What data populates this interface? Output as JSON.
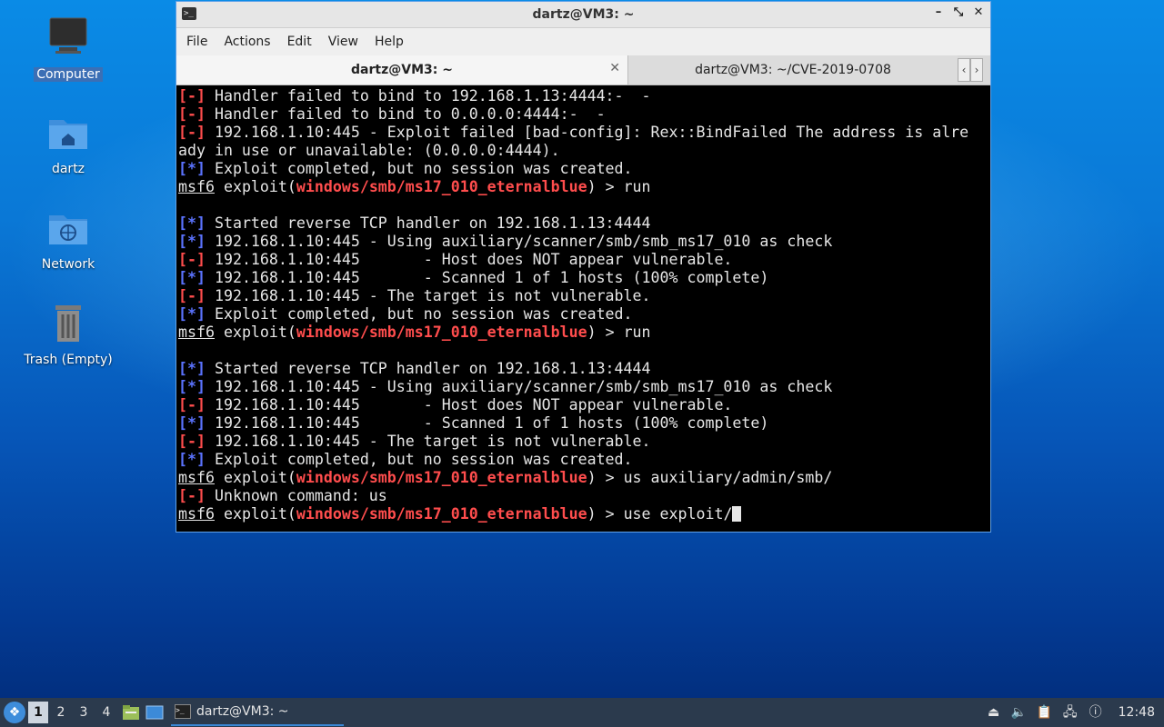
{
  "desktop": {
    "icons": [
      {
        "label": "Computer",
        "icon": "computer-icon"
      },
      {
        "label": "dartz",
        "icon": "home-folder-icon"
      },
      {
        "label": "Network",
        "icon": "network-folder-icon"
      },
      {
        "label": "Trash (Empty)",
        "icon": "trash-icon"
      }
    ]
  },
  "window": {
    "title": "dartz@VM3: ~",
    "menu": [
      "File",
      "Actions",
      "Edit",
      "View",
      "Help"
    ],
    "tabs": [
      {
        "label": "dartz@VM3: ~",
        "active": true
      },
      {
        "label": "dartz@VM3: ~/CVE-2019-0708",
        "active": false
      }
    ],
    "controls": {
      "minimize": "–",
      "maximize": "⤡",
      "close": "✕"
    }
  },
  "terminal": {
    "prompt": "msf6",
    "module": "windows/smb/ms17_010_eternalblue",
    "lines": [
      {
        "type": "err",
        "text": " Handler failed to bind to 192.168.1.13:4444:-  -"
      },
      {
        "type": "err",
        "text": " Handler failed to bind to 0.0.0.0:4444:-  -"
      },
      {
        "type": "err",
        "text": " 192.168.1.10:445 - Exploit failed [bad-config]: Rex::BindFailed The address is alre"
      },
      {
        "type": "plain",
        "text": "ady in use or unavailable: (0.0.0.0:4444)."
      },
      {
        "type": "info",
        "text": " Exploit completed, but no session was created."
      },
      {
        "type": "prompt",
        "text": " > run"
      },
      {
        "type": "blank",
        "text": ""
      },
      {
        "type": "info",
        "text": " Started reverse TCP handler on 192.168.1.13:4444"
      },
      {
        "type": "info",
        "text": " 192.168.1.10:445 - Using auxiliary/scanner/smb/smb_ms17_010 as check"
      },
      {
        "type": "err",
        "text": " 192.168.1.10:445       - Host does NOT appear vulnerable."
      },
      {
        "type": "info",
        "text": " 192.168.1.10:445       - Scanned 1 of 1 hosts (100% complete)"
      },
      {
        "type": "err",
        "text": " 192.168.1.10:445 - The target is not vulnerable."
      },
      {
        "type": "info",
        "text": " Exploit completed, but no session was created."
      },
      {
        "type": "prompt",
        "text": " > run"
      },
      {
        "type": "blank",
        "text": ""
      },
      {
        "type": "info",
        "text": " Started reverse TCP handler on 192.168.1.13:4444"
      },
      {
        "type": "info",
        "text": " 192.168.1.10:445 - Using auxiliary/scanner/smb/smb_ms17_010 as check"
      },
      {
        "type": "err",
        "text": " 192.168.1.10:445       - Host does NOT appear vulnerable."
      },
      {
        "type": "info",
        "text": " 192.168.1.10:445       - Scanned 1 of 1 hosts (100% complete)"
      },
      {
        "type": "err",
        "text": " 192.168.1.10:445 - The target is not vulnerable."
      },
      {
        "type": "info",
        "text": " Exploit completed, but no session was created."
      },
      {
        "type": "prompt",
        "text": " > us auxiliary/admin/smb/"
      },
      {
        "type": "err",
        "text": " Unknown command: us"
      },
      {
        "type": "prompt",
        "text": " > use exploit/",
        "cursor": true
      }
    ],
    "colors": {
      "error": "#ff4d4d",
      "info": "#5b73ff",
      "module": "#ff4d4d",
      "text": "#e6e6e6"
    }
  },
  "taskbar": {
    "workspaces": [
      "1",
      "2",
      "3",
      "4"
    ],
    "active_workspace": "1",
    "task_label": "dartz@VM3: ~",
    "clock": "12:48",
    "tray_icons": [
      "drive-icon",
      "volume-icon",
      "clipboard-icon",
      "network-icon",
      "update-icon"
    ]
  }
}
